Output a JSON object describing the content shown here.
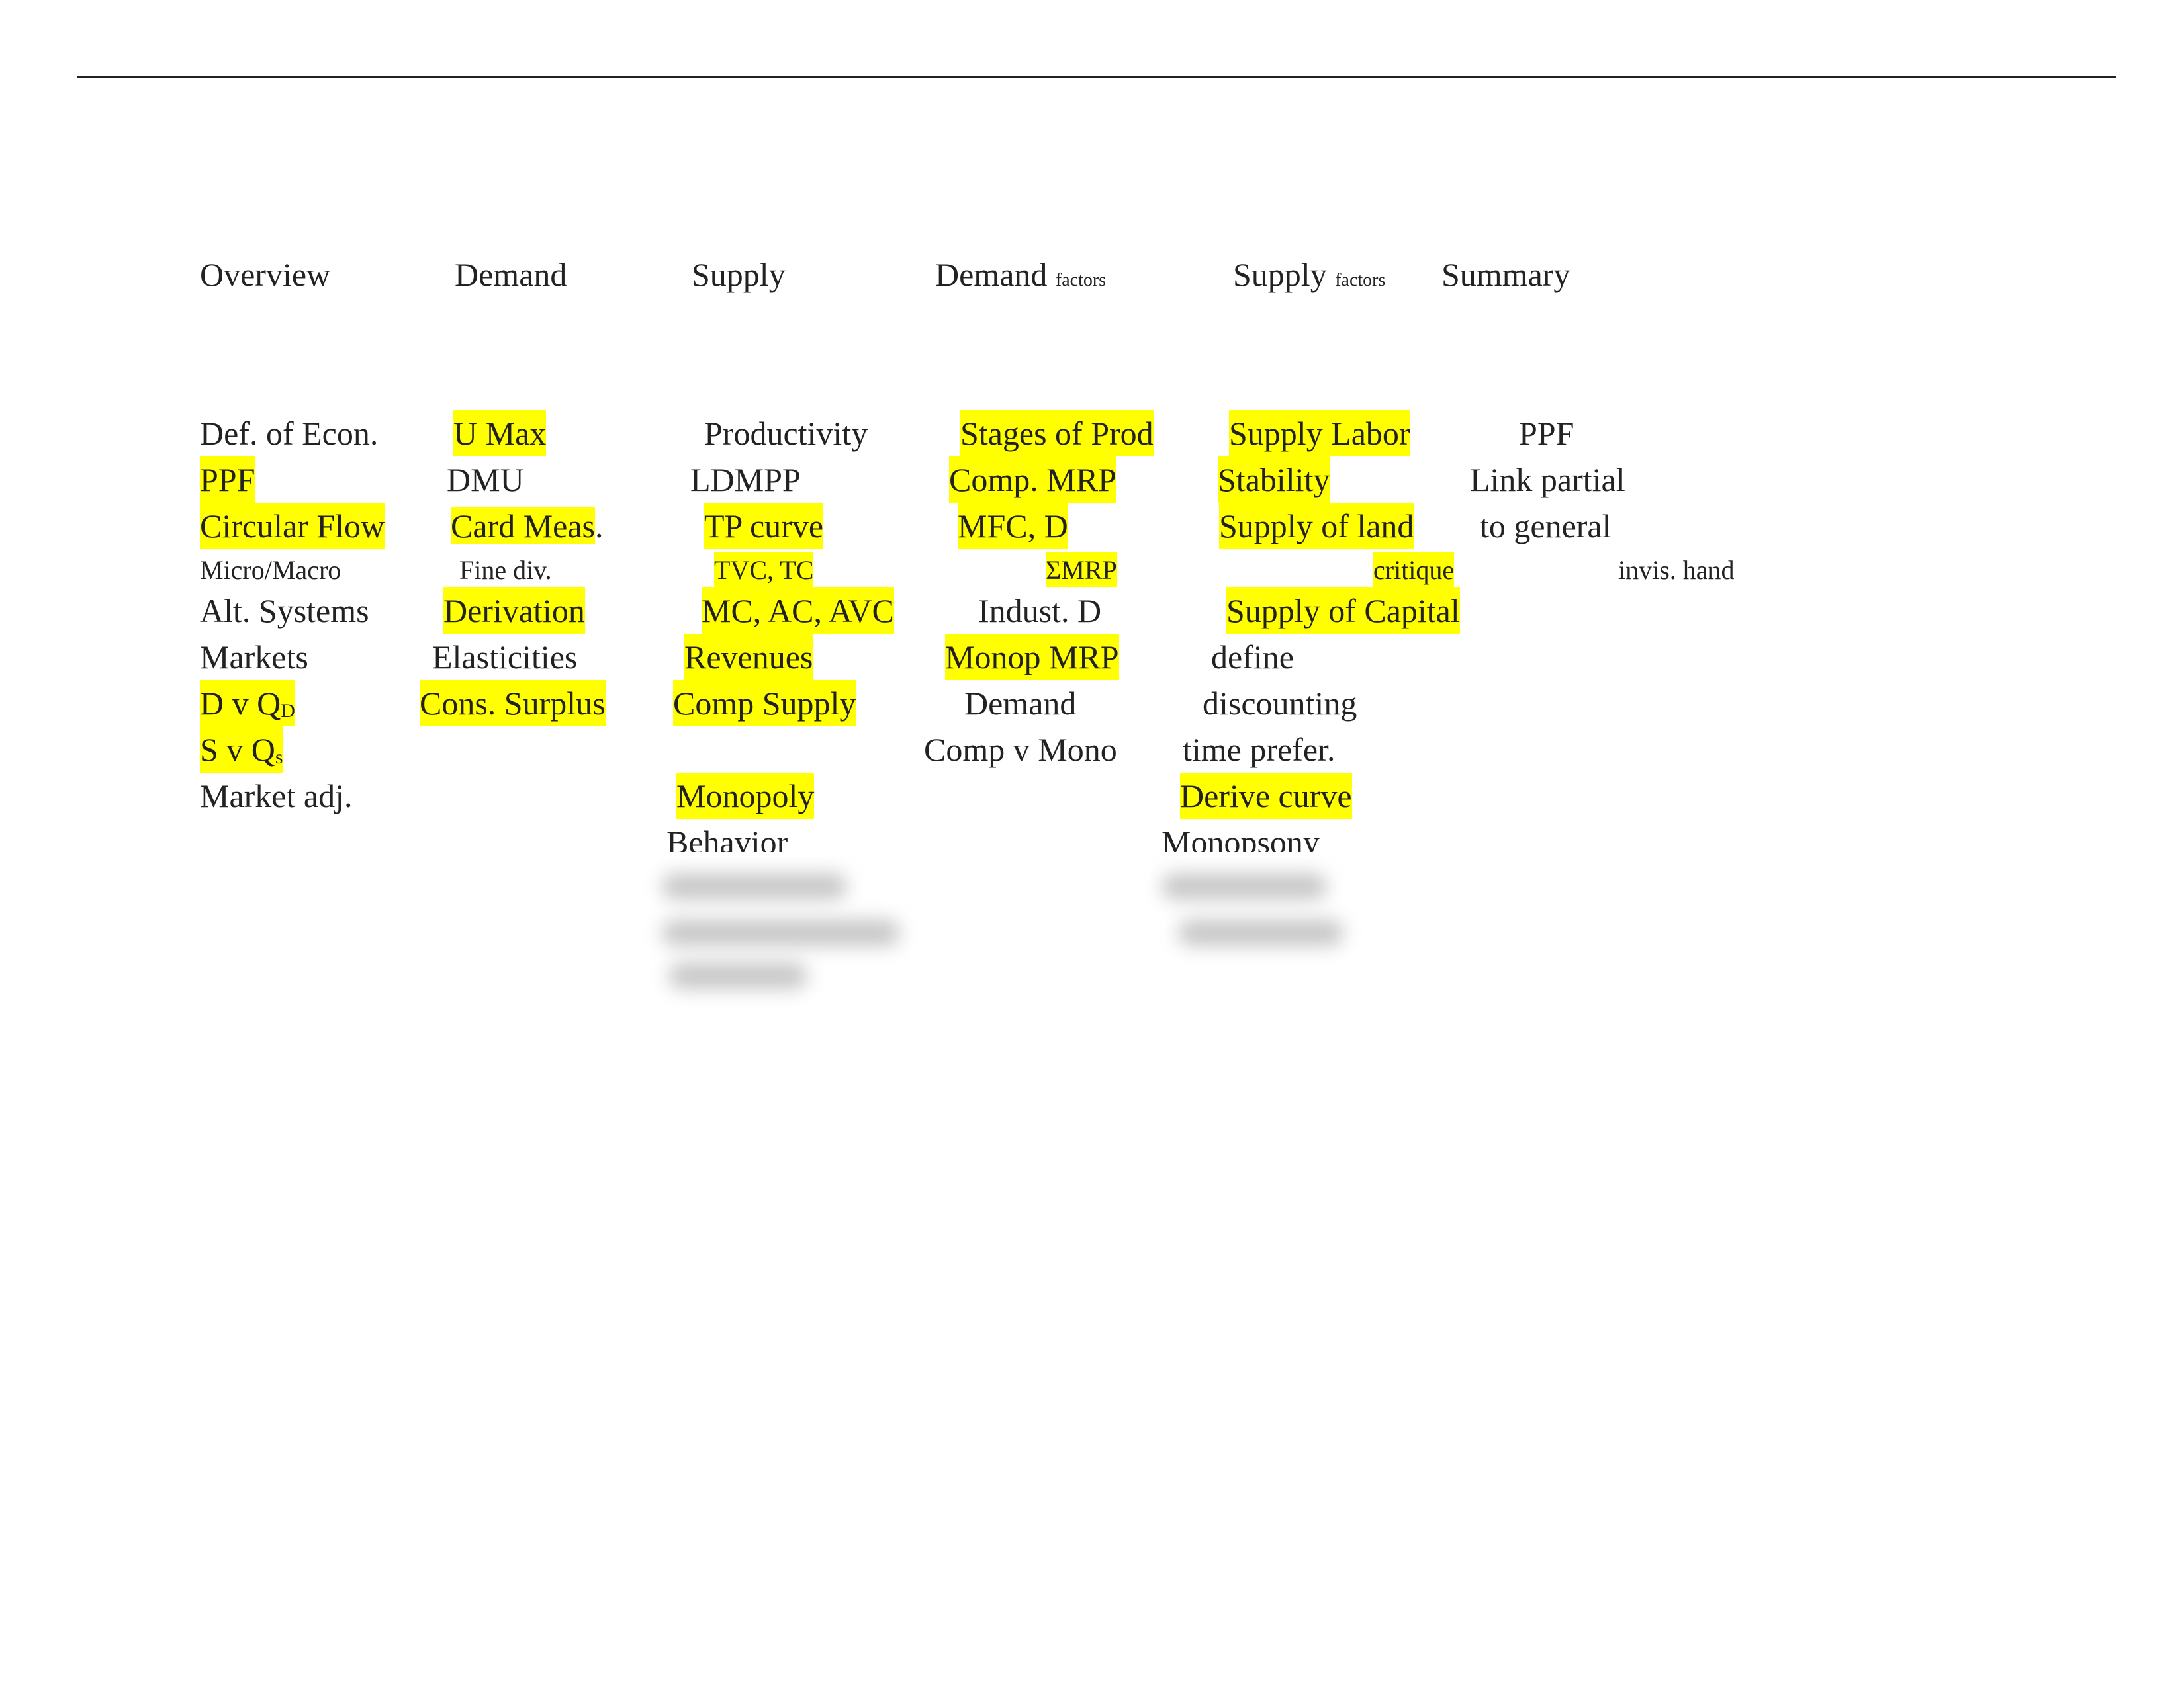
{
  "headers": {
    "overview": "Overview",
    "demand": "Demand",
    "supply": "Supply",
    "demand_factors": "Demand",
    "demand_factors_sub": "factors",
    "supply_factors": "Supply",
    "supply_factors_sub": "factors",
    "summary": "Summary"
  },
  "highlight_color": "#ffff00",
  "overview": [
    "Def. of Econ.",
    "PPF",
    "Circular Flow",
    "Micro/Macro",
    "Alt. Systems",
    "Markets",
    "D v Q",
    "D",
    "S v Q",
    "s",
    "Market adj."
  ],
  "demand": [
    "U Max",
    "DMU",
    "Card Meas",
    ".",
    "Fine div.",
    "Derivation",
    "Elasticities",
    "Cons. Surplus"
  ],
  "supply": [
    "Productivity",
    "LDMPP",
    "TP curve",
    "TVC, TC",
    "MC, AC, AVC",
    "Revenues",
    "Comp Supply",
    "Monopoly",
    "Behavior"
  ],
  "demand_factors": [
    "Stages of Prod",
    "Comp. MRP",
    "MFC, D",
    "ΣMRP",
    "Indust. D",
    "Monop MRP",
    "Demand",
    "Comp v Mono"
  ],
  "supply_factors": [
    "Supply Labor",
    "Stability",
    "Supply of land",
    "critique",
    "Supply of Capital",
    "define",
    "discounting",
    "time prefer.",
    "Derive curve",
    "Monopsony"
  ],
  "summary": [
    "PPF",
    "Link partial",
    "to general",
    "invis. hand"
  ]
}
